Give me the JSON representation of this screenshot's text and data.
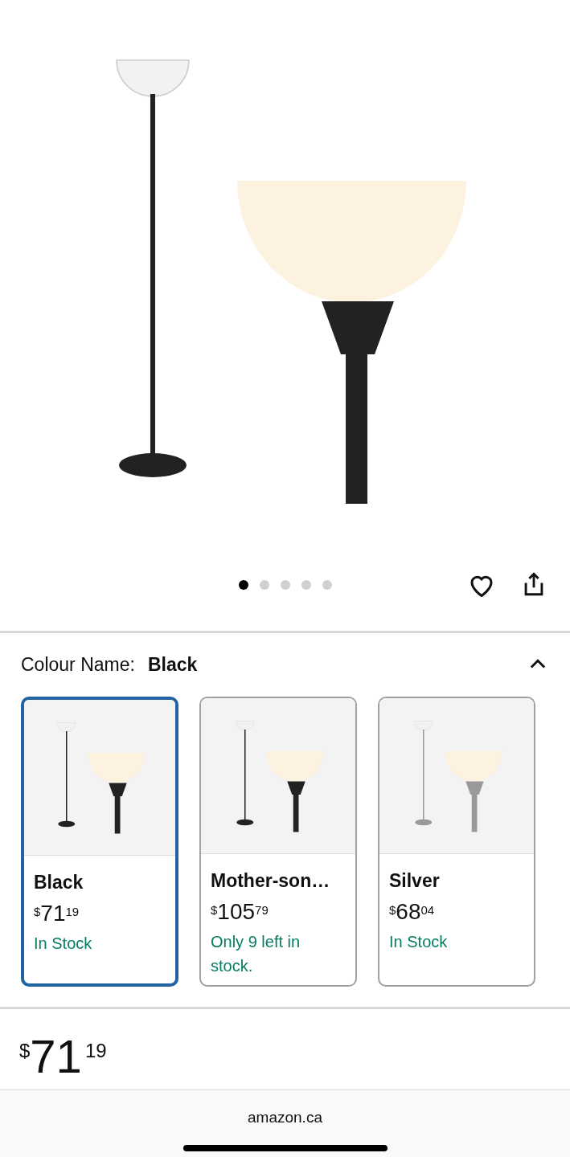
{
  "image_dots": [
    {
      "selected": true
    },
    {
      "selected": false
    },
    {
      "selected": false
    },
    {
      "selected": false
    },
    {
      "selected": false
    }
  ],
  "variation": {
    "label": "Colour Name:",
    "value": "Black",
    "expanded": true
  },
  "options": [
    {
      "name": "Black",
      "currency": "$",
      "whole": "71",
      "fraction": "19",
      "availability": "In Stock",
      "selected": true
    },
    {
      "name": "Mother-son…",
      "currency": "$",
      "whole": "105",
      "fraction": "79",
      "availability": "Only 9 left in stock.",
      "selected": false
    },
    {
      "name": "Silver",
      "currency": "$",
      "whole": "68",
      "fraction": "04",
      "availability": "In Stock",
      "selected": false
    }
  ],
  "price": {
    "currency": "$",
    "whole": "71",
    "fraction": "19"
  },
  "browser_bar": {
    "url": "amazon.ca"
  }
}
